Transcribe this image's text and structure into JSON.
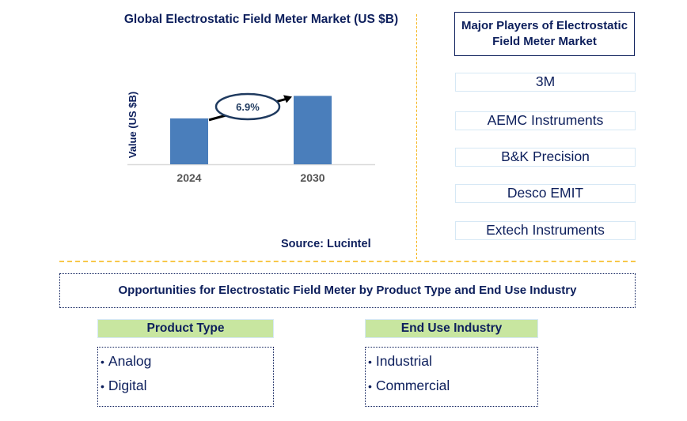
{
  "chart_data": {
    "type": "bar",
    "title": "Global Electrostatic Field Meter Market (US $B)",
    "xlabel": "",
    "ylabel": "Value (US $B)",
    "categories": [
      "2024",
      "2030"
    ],
    "values": [
      1.0,
      1.49
    ],
    "value_note": "relative heights (no value labels shown)",
    "ylim": [
      0,
      1.6
    ],
    "grid": false,
    "annotation": {
      "text": "6.9%",
      "type": "growth-arrow",
      "from": "2024",
      "to": "2030"
    },
    "bar_color": "#4a7ebb",
    "source": "Source: Lucintel"
  },
  "players": {
    "title": "Major Players of Electrostatic Field Meter Market",
    "items": [
      "3M",
      "AEMC Instruments",
      "B&K Precision",
      "Desco EMIT",
      "Extech Instruments"
    ]
  },
  "opportunities": {
    "title": "Opportunities for Electrostatic Field Meter by Product Type and End Use Industry",
    "segments": [
      {
        "heading": "Product Type",
        "items": [
          "Analog",
          "Digital"
        ]
      },
      {
        "heading": "End Use Industry",
        "items": [
          "Industrial",
          "Commercial"
        ]
      }
    ]
  },
  "colors": {
    "navy": "#0d1f5c",
    "bar": "#4a7ebb",
    "divider": "#f5b417",
    "segment_header": "#c8e6a0"
  }
}
